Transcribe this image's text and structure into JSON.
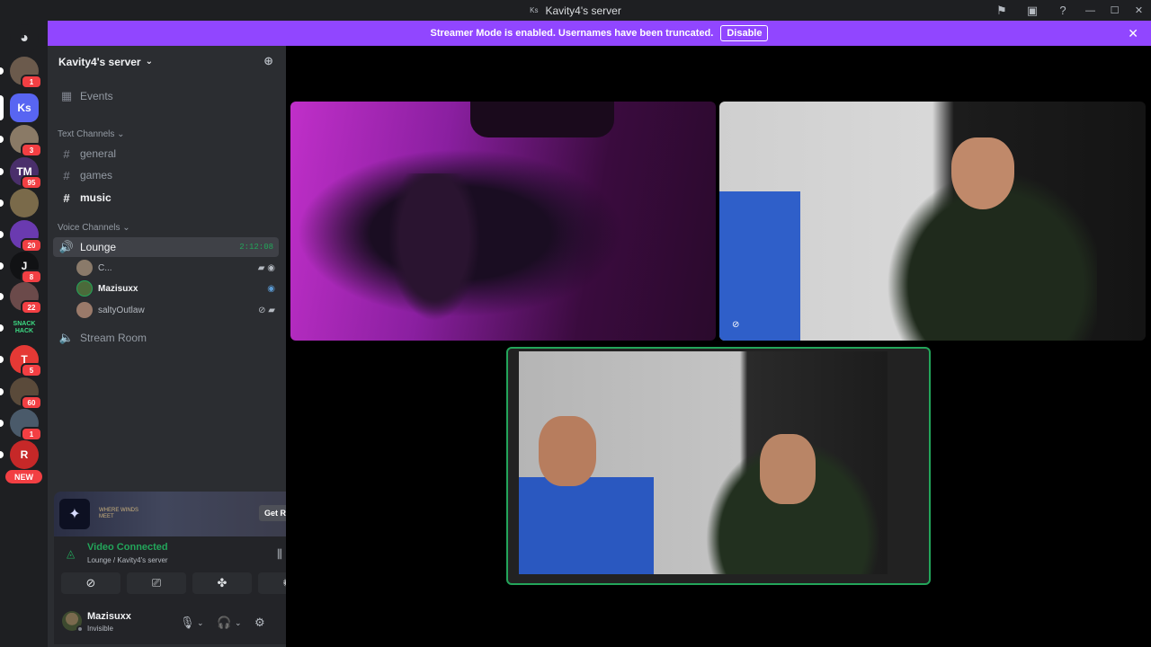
{
  "window": {
    "title": "Kavity4's server",
    "server_badge": "Ks"
  },
  "banner": {
    "message": "Streamer Mode is enabled. Usernames have been truncated.",
    "button": "Disable"
  },
  "guilds": [
    {
      "name": "guild-1",
      "label": "",
      "badge": "1",
      "color": "#6b5a4c"
    },
    {
      "name": "guild-ks",
      "label": "Ks",
      "badge": "",
      "color": "#5865f2"
    },
    {
      "name": "guild-3",
      "label": "",
      "badge": "3",
      "color": "#8a7a66"
    },
    {
      "name": "guild-tm",
      "label": "TM",
      "badge": "95",
      "color": "#4a2f6b"
    },
    {
      "name": "guild-5",
      "label": "",
      "badge": "",
      "color": "#7a6a4a"
    },
    {
      "name": "guild-6",
      "label": "",
      "badge": "20",
      "color": "#6a3ab0"
    },
    {
      "name": "guild-j",
      "label": "J",
      "badge": "8",
      "color": "#111214"
    },
    {
      "name": "guild-8",
      "label": "",
      "badge": "22",
      "color": "#6b4a4a"
    },
    {
      "name": "guild-snack",
      "label": "SNACK HACK",
      "badge": "",
      "color": "#1e1f22"
    },
    {
      "name": "guild-t",
      "label": "T",
      "badge": "5",
      "color": "#e53935"
    },
    {
      "name": "guild-11",
      "label": "",
      "badge": "60",
      "color": "#5a4a3a"
    },
    {
      "name": "guild-12",
      "label": "",
      "badge": "1",
      "color": "#4a5a6a"
    },
    {
      "name": "guild-13",
      "label": "R",
      "badge": "",
      "color": "#c62828"
    }
  ],
  "guild_new_label": "NEW",
  "sidebar": {
    "server_name": "Kavity4's server",
    "events": "Events",
    "text_category": "Text Channels",
    "text_channels": [
      "general",
      "games",
      "music"
    ],
    "voice_category": "Voice Channels",
    "voice_channels": [
      {
        "name": "Lounge",
        "timer": "2:12:08"
      },
      {
        "name": "Stream Room",
        "timer": ""
      }
    ],
    "voice_users": [
      "C...",
      "Mazisuxx",
      "saltyOutlaw"
    ]
  },
  "promo": {
    "text": "WHERE WINDS MEET",
    "button": "Get Reward!"
  },
  "voice": {
    "status": "Video Connected",
    "location": "Lounge / Kavity4's server"
  },
  "user": {
    "name": "Mazisuxx",
    "status": "Invisible"
  }
}
